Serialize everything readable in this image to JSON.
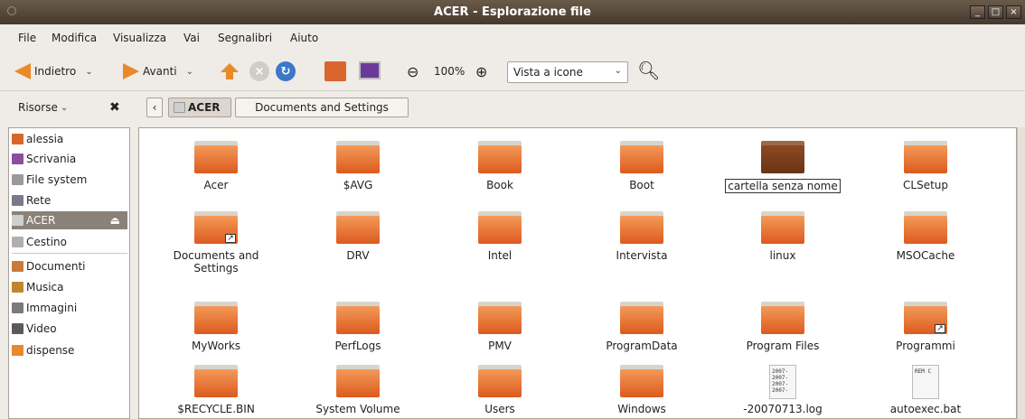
{
  "window": {
    "title": "ACER - Esplorazione file",
    "min": "_",
    "max": "□",
    "close": "×"
  },
  "menu": [
    "File",
    "Modifica",
    "Visualizza",
    "Vai",
    "Segnalibri",
    "Aiuto"
  ],
  "toolbar": {
    "back_label": "Indietro",
    "forward_label": "Avanti",
    "zoom_value": "100%",
    "view_mode": "Vista a icone"
  },
  "location": {
    "panel_selector": "Risorse",
    "path": [
      "ACER",
      "Documents and Settings"
    ]
  },
  "sidebar": {
    "items": [
      {
        "label": "alessia",
        "icon": "home-icon",
        "color": "#d9662b"
      },
      {
        "label": "Scrivania",
        "icon": "desktop-icon",
        "color": "#8a4fa0"
      },
      {
        "label": "File system",
        "icon": "drive-icon",
        "color": "#9a9a9a"
      },
      {
        "label": "Rete",
        "icon": "network-icon",
        "color": "#7a7a8a"
      },
      {
        "label": "ACER",
        "icon": "drive-icon",
        "color": "#cfcfcf",
        "eject": "⏏"
      },
      {
        "label": "Cestino",
        "icon": "trash-icon",
        "color": "#b0b0b0"
      },
      {
        "label": "Documenti",
        "icon": "documents-icon",
        "color": "#c97a3a"
      },
      {
        "label": "Musica",
        "icon": "music-icon",
        "color": "#c2852f"
      },
      {
        "label": "Immagini",
        "icon": "pictures-icon",
        "color": "#7a7a7a"
      },
      {
        "label": "Video",
        "icon": "video-icon",
        "color": "#5a5a5a"
      },
      {
        "label": "dispense",
        "icon": "folder-icon",
        "color": "#e8872d"
      }
    ]
  },
  "files": [
    {
      "name": "Acer",
      "type": "folder"
    },
    {
      "name": "$AVG",
      "type": "folder"
    },
    {
      "name": "Book",
      "type": "folder"
    },
    {
      "name": "Boot",
      "type": "folder"
    },
    {
      "name": "cartella senza nome",
      "type": "folder-dark"
    },
    {
      "name": "CLSetup",
      "type": "folder"
    },
    {
      "name": "Documents and Settings",
      "type": "folder-link"
    },
    {
      "name": "DRV",
      "type": "folder"
    },
    {
      "name": "Intel",
      "type": "folder"
    },
    {
      "name": "Intervista",
      "type": "folder"
    },
    {
      "name": "linux",
      "type": "folder"
    },
    {
      "name": "MSOCache",
      "type": "folder"
    },
    {
      "name": "MyWorks",
      "type": "folder"
    },
    {
      "name": "PerfLogs",
      "type": "folder"
    },
    {
      "name": "PMV",
      "type": "folder"
    },
    {
      "name": "ProgramData",
      "type": "folder"
    },
    {
      "name": "Program Files",
      "type": "folder"
    },
    {
      "name": "Programmi",
      "type": "folder-link"
    },
    {
      "name": "$RECYCLE.BIN",
      "type": "folder"
    },
    {
      "name": "System Volume",
      "type": "folder"
    },
    {
      "name": "Users",
      "type": "folder"
    },
    {
      "name": "Windows",
      "type": "folder"
    },
    {
      "name": "-20070713.log",
      "type": "file",
      "preview": "2007-\n2007-\n2007-\n2007-"
    },
    {
      "name": "autoexec.bat",
      "type": "file",
      "preview": "REM C"
    }
  ]
}
